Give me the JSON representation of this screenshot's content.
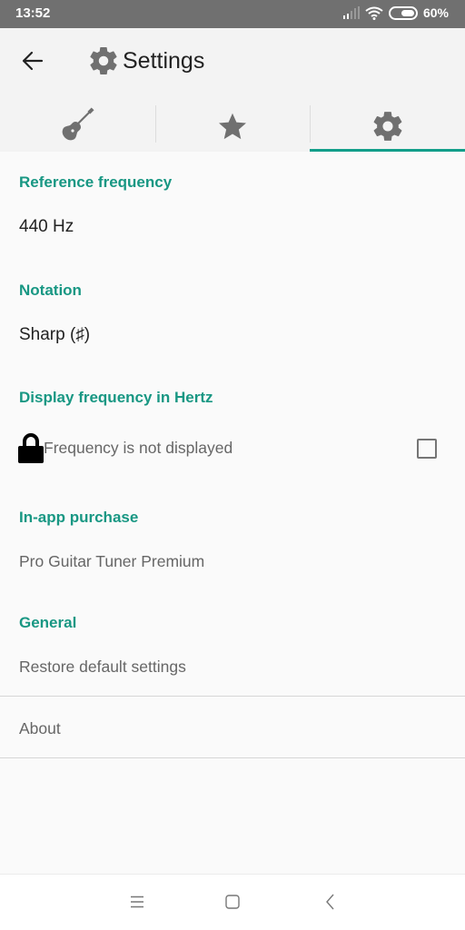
{
  "status_bar": {
    "time": "13:52",
    "battery_percent": "60%",
    "battery_level": 0.6,
    "signal_icon": "cellular-signal-icon",
    "wifi_icon": "wifi-icon"
  },
  "app_bar": {
    "back_icon": "arrow-left-icon",
    "title_icon": "gear-icon",
    "title": "Settings"
  },
  "tabs": [
    {
      "id": "tuner",
      "icon": "guitar-icon",
      "active": false
    },
    {
      "id": "favorites",
      "icon": "star-icon",
      "active": false
    },
    {
      "id": "settings",
      "icon": "gear-icon",
      "active": true
    }
  ],
  "settings": {
    "reference_frequency": {
      "category": "Reference frequency",
      "value": "440 Hz"
    },
    "notation": {
      "category": "Notation",
      "value": "Sharp (♯)"
    },
    "display_frequency": {
      "category": "Display frequency in Hertz",
      "summary": "Frequency is not displayed",
      "checked": false,
      "locked": true
    },
    "in_app_purchase": {
      "category": "In-app purchase",
      "item": "Pro Guitar Tuner Premium"
    },
    "general": {
      "category": "General",
      "restore": "Restore default settings",
      "about": "About"
    }
  },
  "colors": {
    "accent": "#129e8a",
    "category_text": "#189783",
    "status_bar": "#707070"
  },
  "nav_bar": {
    "menu_icon": "menu-icon",
    "home_icon": "home-square-icon",
    "back_icon": "chevron-left-icon"
  }
}
